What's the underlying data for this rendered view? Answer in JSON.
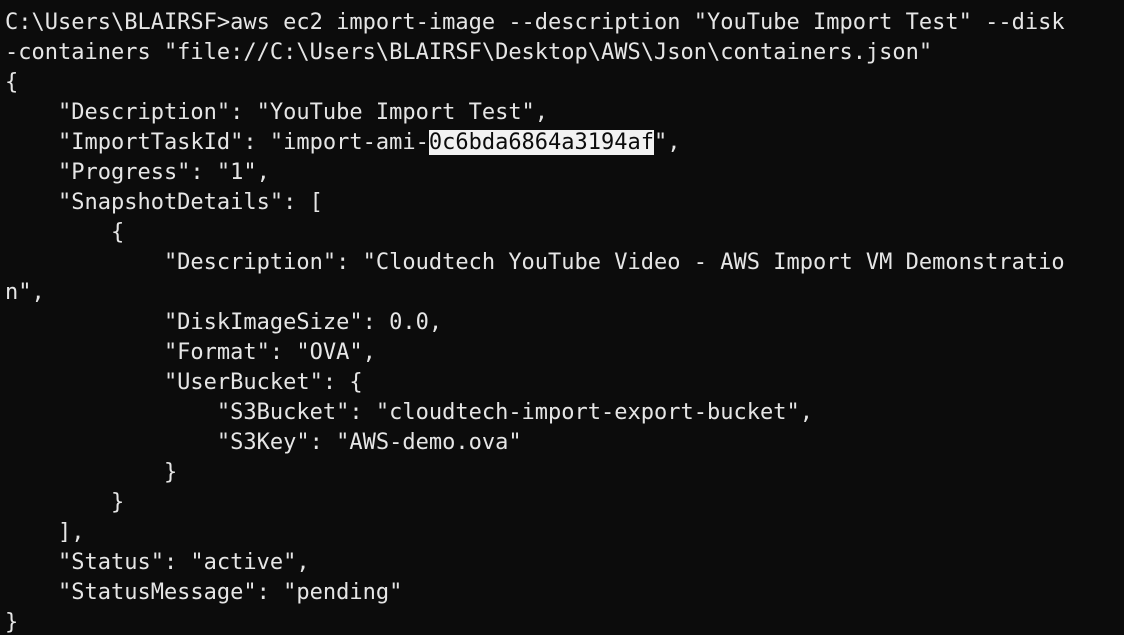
{
  "terminal": {
    "lines": [
      "C:\\Users\\BLAIRSF>aws ec2 import-image --description \"YouTube Import Test\" --disk",
      "-containers \"file://C:\\Users\\BLAIRSF\\Desktop\\AWS\\Json\\containers.json\"",
      "{",
      "    \"Description\": \"YouTube Import Test\",",
      {
        "before": "    \"ImportTaskId\": \"import-ami-",
        "selected": "0c6bda6864a3194af",
        "after": "\","
      },
      "    \"Progress\": \"1\",",
      "    \"SnapshotDetails\": [",
      "        {",
      "            \"Description\": \"Cloudtech YouTube Video - AWS Import VM Demonstratio",
      "n\",",
      "            \"DiskImageSize\": 0.0,",
      "            \"Format\": \"OVA\",",
      "            \"UserBucket\": {",
      "                \"S3Bucket\": \"cloudtech-import-export-bucket\",",
      "                \"S3Key\": \"AWS-demo.ova\"",
      "            }",
      "        }",
      "    ],",
      "    \"Status\": \"active\",",
      "    \"StatusMessage\": \"pending\"",
      "}"
    ]
  }
}
